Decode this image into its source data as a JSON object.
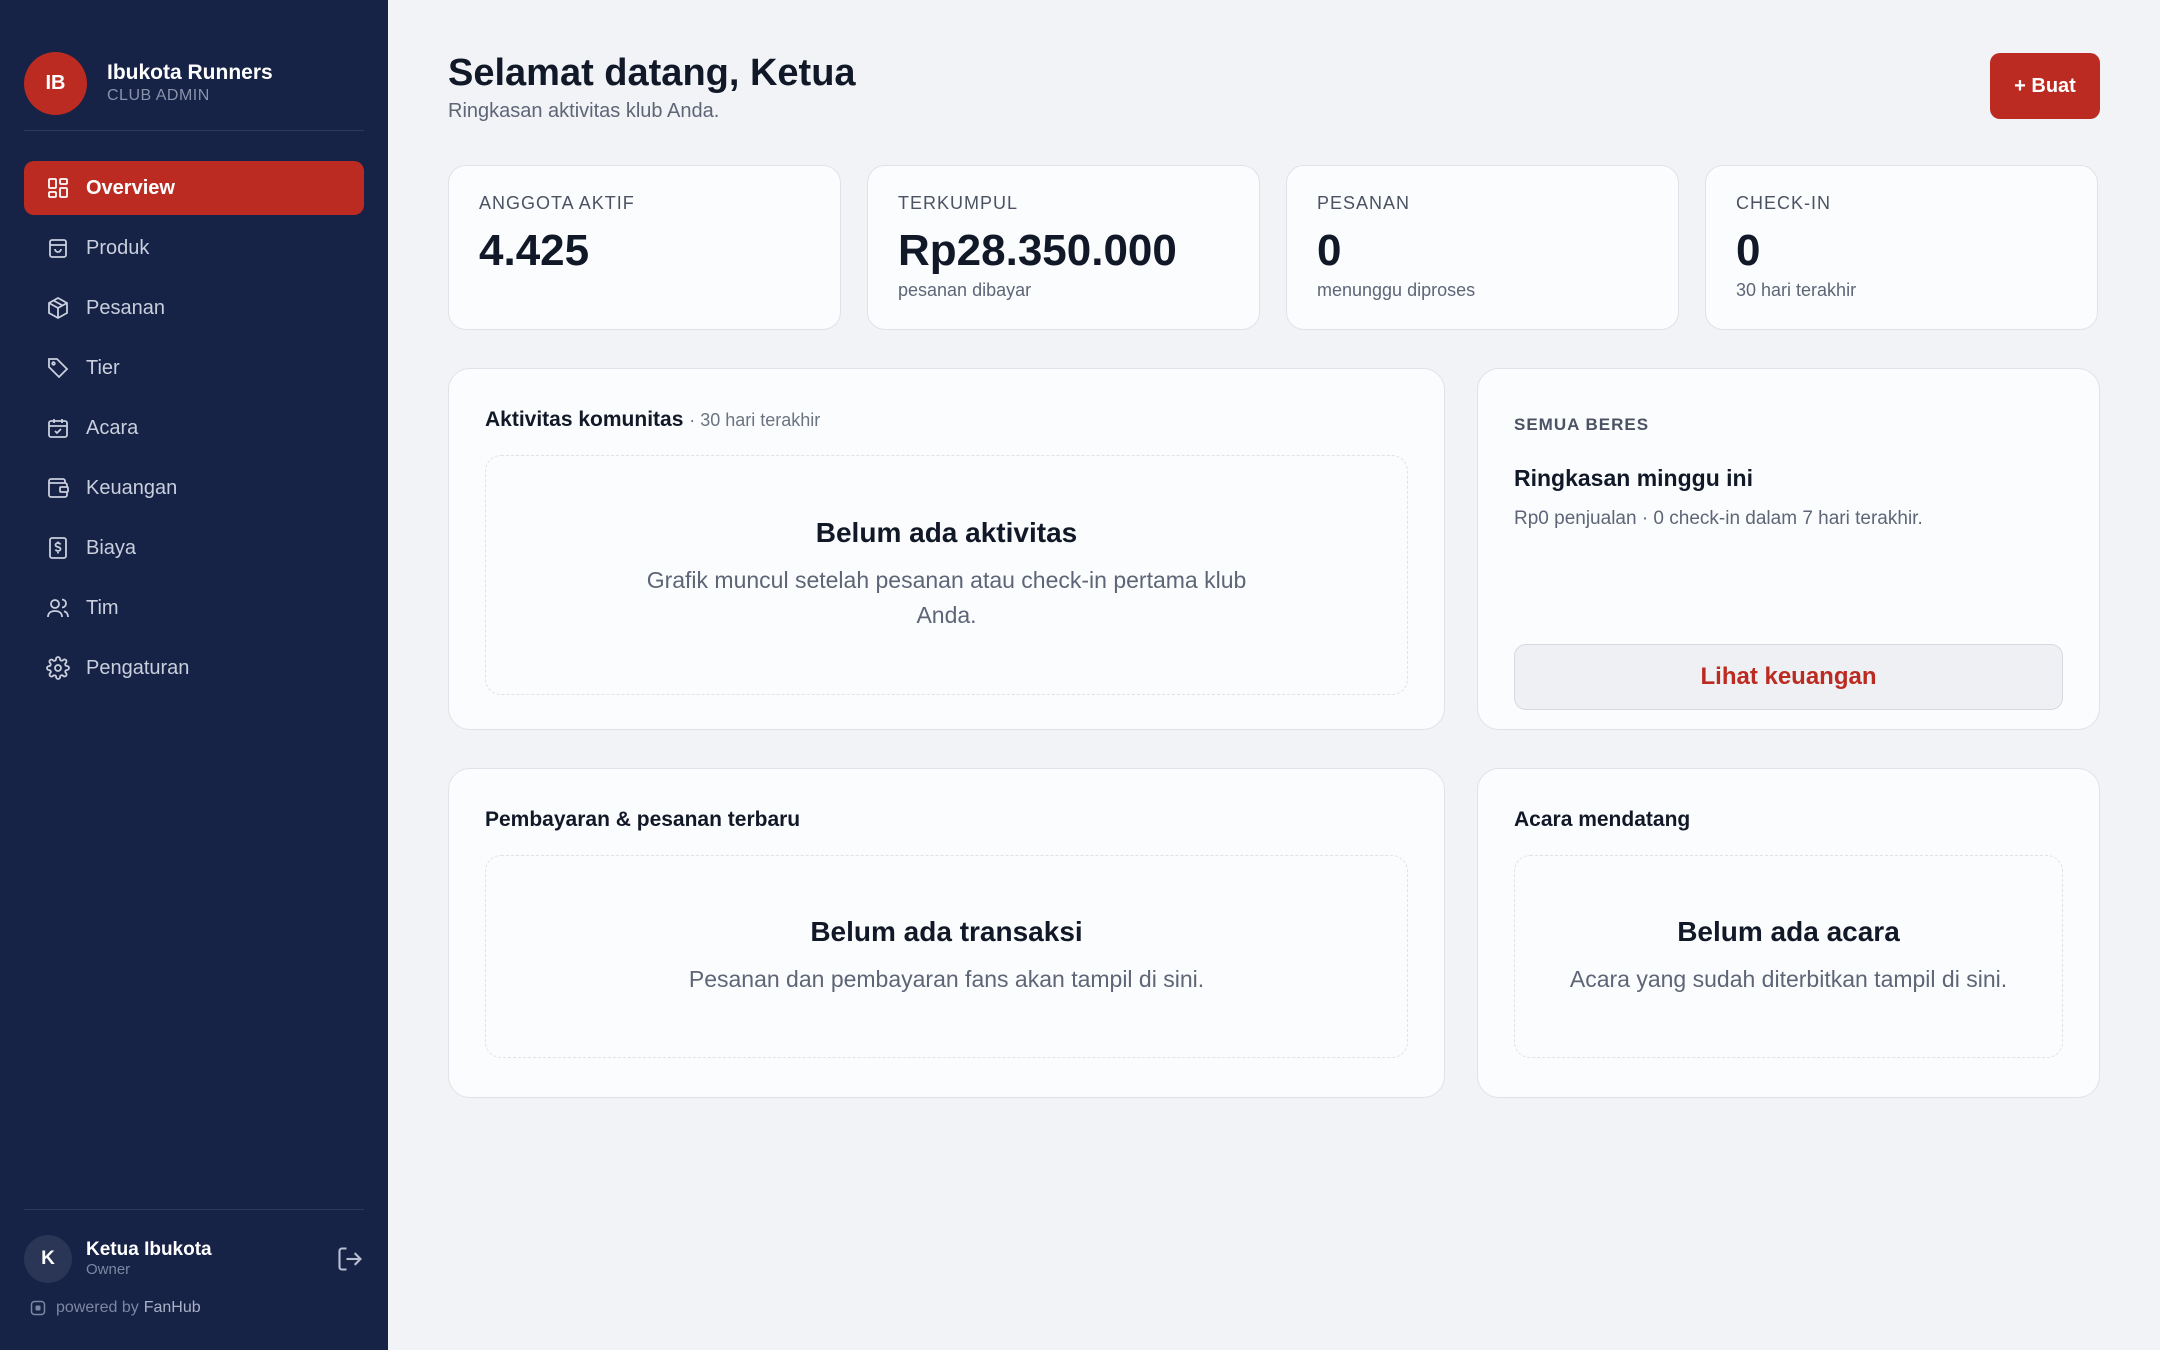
{
  "brand": {
    "initials": "IB",
    "name": "Ibukota Runners",
    "role": "CLUB ADMIN"
  },
  "nav": [
    {
      "label": "Overview",
      "icon": "grid-icon",
      "active": true
    },
    {
      "label": "Produk",
      "icon": "bag-icon"
    },
    {
      "label": "Pesanan",
      "icon": "box-icon"
    },
    {
      "label": "Tier",
      "icon": "tag-icon"
    },
    {
      "label": "Acara",
      "icon": "calendar-icon"
    },
    {
      "label": "Keuangan",
      "icon": "wallet-icon"
    },
    {
      "label": "Biaya",
      "icon": "receipt-icon"
    },
    {
      "label": "Tim",
      "icon": "users-icon"
    },
    {
      "label": "Pengaturan",
      "icon": "gear-icon"
    }
  ],
  "user": {
    "initial": "K",
    "name": "Ketua Ibukota",
    "role": "Owner"
  },
  "powered": {
    "prefix": "powered by",
    "brand": "FanHub"
  },
  "header": {
    "title": "Selamat datang, Ketua",
    "subtitle": "Ringkasan aktivitas klub Anda.",
    "create_label": "+ Buat"
  },
  "stats": [
    {
      "label": "ANGGOTA AKTIF",
      "value": "4.425",
      "sub": ""
    },
    {
      "label": "TERKUMPUL",
      "value": "Rp28.350.000",
      "sub": "pesanan dibayar"
    },
    {
      "label": "PESANAN",
      "value": "0",
      "sub": "menunggu diproses"
    },
    {
      "label": "CHECK-IN",
      "value": "0",
      "sub": "30 hari terakhir"
    }
  ],
  "activity": {
    "title": "Aktivitas komunitas",
    "range": "· 30 hari terakhir",
    "empty_title": "Belum ada aktivitas",
    "empty_desc": "Grafik muncul setelah pesanan atau check-in pertama klub Anda."
  },
  "summary": {
    "kicker": "SEMUA BERES",
    "title": "Ringkasan minggu ini",
    "desc": "Rp0 penjualan · 0 check-in dalam 7 hari terakhir.",
    "button": "Lihat keuangan"
  },
  "payments": {
    "title": "Pembayaran & pesanan terbaru",
    "empty_title": "Belum ada transaksi",
    "empty_desc": "Pesanan dan pembayaran fans akan tampil di sini."
  },
  "events": {
    "title": "Acara mendatang",
    "empty_title": "Belum ada acara",
    "empty_desc": "Acara yang sudah diterbitkan tampil di sini."
  },
  "colors": {
    "sidebar": "#162246",
    "accent": "#bb2b22",
    "background": "#f2f3f6"
  }
}
